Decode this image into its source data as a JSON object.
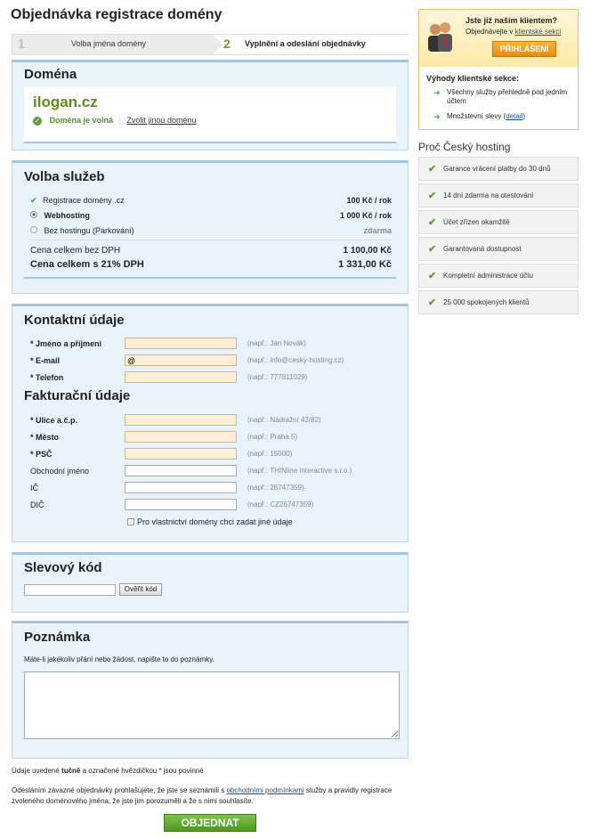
{
  "page_title": "Objednávka registrace domény",
  "steps": [
    {
      "num": "1",
      "label": "Volba jména domény"
    },
    {
      "num": "2",
      "label": "Vyplnění a odeslání objednávky"
    }
  ],
  "domain": {
    "heading": "Doména",
    "name": "ilogan.cz",
    "status": "Doména je volná",
    "change_link": "Zvolit jinou doménu"
  },
  "services": {
    "heading": "Volba služeb",
    "rows": [
      {
        "label": "Registrace domény .cz",
        "price": "100 Kč / rok"
      },
      {
        "label": "Webhosting",
        "price": "1 000 Kč / rok"
      },
      {
        "label": "Bez hostingu (Parkování)",
        "price": "zdarma"
      }
    ],
    "total_net_label": "Cena celkem bez DPH",
    "total_net": "1 100,00 Kč",
    "total_gross_label": "Cena celkem s 21% DPH",
    "total_gross": "1 331,00 Kč"
  },
  "contact": {
    "heading": "Kontaktní údaje",
    "fields": [
      {
        "label": "* Jméno a příjmení",
        "value": "",
        "hint": "(např.: Jan Novák)"
      },
      {
        "label": "* E-mail",
        "value": "@",
        "hint": "(např.: info@cesky-hosting.cz)"
      },
      {
        "label": "* Telefon",
        "value": "",
        "hint": "(např.: 777811029)"
      }
    ]
  },
  "billing": {
    "heading": "Fakturační údaje",
    "fields": [
      {
        "label": "* Ulice a č.p.",
        "value": "",
        "hint": "(např.: Nádražní 42/82)"
      },
      {
        "label": "* Město",
        "value": "",
        "hint": "(např.: Praha 5)"
      },
      {
        "label": "* PSČ",
        "value": "",
        "hint": "(např.: 15000)"
      },
      {
        "label": "Obchodní jméno",
        "value": "",
        "hint": "(např.: THINline interactive s.r.o.)"
      },
      {
        "label": "IČ",
        "value": "",
        "hint": "(např.: 26747359)"
      },
      {
        "label": "DIČ",
        "value": "",
        "hint": "(např.: CZ26747359)"
      }
    ],
    "owner_checkbox": "Pro vlastnictví domény chci zadat jiné údaje"
  },
  "discount": {
    "heading": "Slevový kód",
    "button": "Ověřit kód"
  },
  "note": {
    "heading": "Poznámka",
    "description": "Máte-li jakékoliv přání nebo žádost, napište to do poznámky."
  },
  "footer": {
    "required_a": "Údaje uvedené ",
    "required_b": "tučně",
    "required_c": " a označené hvězdičkou * jsou povinné",
    "terms_a": "Odesláním závazné objednávky prohlašujete, že jste se seznámili s ",
    "terms_link": "obchodními podmínkami",
    "terms_b": " služby a pravidly registrace zvoleného doménového jména, že jste jim porozuměli a že s nimi souhlasíte.",
    "submit": "OBJEDNAT"
  },
  "client_box": {
    "title": "Jste již naším klientem?",
    "subtitle_a": "Objednávejte v ",
    "subtitle_link": "klientské sekci",
    "login_button": "PŘIHLÁŠENÍ",
    "benefits_title": "Výhody klientské sekce:",
    "benefit1": "Všechny služby přehledně pod jedním účtem",
    "benefit2_a": "Množstevní slevy (",
    "benefit2_link": "detail",
    "benefit2_b": ")"
  },
  "why": {
    "heading": "Proč Český hosting",
    "items": [
      "Garance vrácení platby do 30 dnů",
      "14 dní zdarma na otestování",
      "Účet zřízen okamžitě",
      "Garantovaná dostupnost",
      "Kompletní administrace účtu",
      "25 000 spokojených klientů"
    ]
  },
  "colors": {
    "accent_green": "#5ea12b",
    "box_blue": "#e9f3fb",
    "orange": "#f29a12"
  }
}
